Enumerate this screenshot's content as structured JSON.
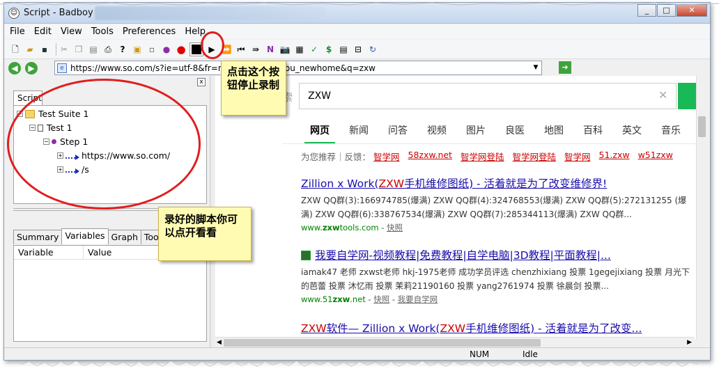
{
  "window": {
    "title": "Script - Badboy",
    "controls": [
      "_",
      "□",
      "✕"
    ]
  },
  "menu": [
    "File",
    "Edit",
    "View",
    "Tools",
    "Preferences",
    "Help"
  ],
  "address": {
    "url": "https://www.so.com/s?ie=utf-8&fr=none&src=360sou_newhome&q=zxw",
    "back_icon": "back-arrow-icon",
    "forward_icon": "forward-arrow-icon"
  },
  "left_panel": {
    "script_tab": "Script",
    "tree": {
      "suite": "Test Suite 1",
      "test": "Test 1",
      "step": "Step 1",
      "request1": "https://www.so.com/",
      "request2": "/s"
    },
    "bottom_tabs": [
      "Summary",
      "Variables",
      "Graph",
      "Too"
    ],
    "active_tab": "Variables",
    "columns": [
      "Variable",
      "Value"
    ]
  },
  "browser": {
    "search_logo_partial": "索",
    "query": "ZXW",
    "nav_tabs": [
      "网页",
      "新闻",
      "问答",
      "视频",
      "图片",
      "良医",
      "地图",
      "百科",
      "英文",
      "音乐"
    ],
    "recommend_label": "为您推荐｜反馈：",
    "recommend_items": [
      "智学网",
      "58zxw.net",
      "智学网登陆",
      "智学网登陆",
      "智学网",
      "51.zxw",
      "w51zxw"
    ],
    "results": [
      {
        "title_pre": "Zillion x Work(",
        "title_hl": "ZXW",
        "title_post": "手机维修图纸) - 活着就是为了改变维修界!",
        "snippet": "ZXW QQ群(3):166974785(爆满) ZXW QQ群(4):324768553(爆满) ZXW QQ群(5):272131255 (爆满) ZXW QQ群(6):338767534(爆满) ZXW QQ群(7):285344113(爆满) ZXW QQ群...",
        "url_pre": "www.",
        "url_hl": "zxw",
        "url_post": "tools.com",
        "cache": "快照"
      },
      {
        "title": "我要自学网-视频教程|免费教程|自学电脑|3D教程|平面教程|...",
        "snippet": "iamak47 老师 zxwst老师 hkj-1975老师 成功学员评选 chenzhixiang 投票 1gegejixiang 投票 月光下的芭蕾 投票 沐忆雨 投票 茉莉21190160 投票 yang2761974 投票 徐晨剑 投票...",
        "url_pre": "www.51",
        "url_hl": "zxw",
        "url_post": ".net",
        "cache": "快照",
        "extra_link": "我要自学网"
      },
      {
        "title_hl": "ZXW",
        "title_mid": "软件— Zillion x Work(",
        "title_hl2": "ZXW",
        "title_post": "手机维修图纸) - 活着就是为了改变..."
      }
    ]
  },
  "status": {
    "num": "NUM",
    "idle": "Idle"
  },
  "annotations": {
    "stop_callout": "点击这个按钮停止录制",
    "script_callout": "录好的脚本你可以点开看看"
  },
  "colors": {
    "annotation_red": "#e01e1e",
    "callout_bg": "#fffbb3",
    "link_blue": "#1a0dab",
    "highlight_red": "#cc0000",
    "url_green": "#008000",
    "search_green": "#19b955"
  }
}
